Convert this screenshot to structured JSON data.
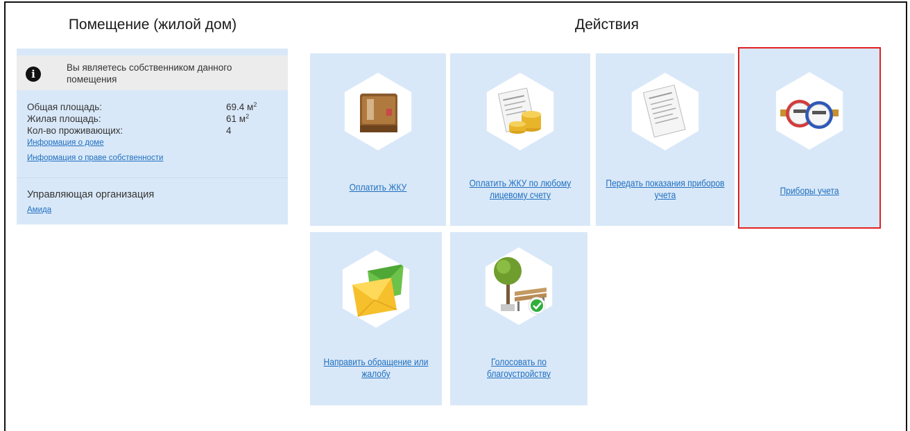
{
  "left_panel": {
    "title": "Помещение (жилой дом)",
    "notice": "Вы являетесь собственником данного помещения",
    "notice_icon": "info-icon",
    "properties": [
      {
        "label": "Общая площадь:",
        "value": "69.4 м",
        "sup": "2"
      },
      {
        "label": "Жилая площадь:",
        "value": "61 м",
        "sup": "2"
      },
      {
        "label": "Кол-во проживающих:",
        "value": "4",
        "sup": ""
      }
    ],
    "links": [
      "Информация о доме",
      "Информация о праве собственности"
    ],
    "management_label": "Управляющая организация",
    "management_link": "Амида"
  },
  "actions": {
    "title": "Действия",
    "tiles": [
      {
        "label": "Оплатить ЖКУ",
        "icon": "wallet-icon"
      },
      {
        "label": "Оплатить ЖКУ по любому лицевому счету",
        "icon": "receipt-coins-icon"
      },
      {
        "label": "Передать показания приборов учета",
        "icon": "receipt-icon"
      },
      {
        "label": "Приборы учета",
        "icon": "water-meter-icon",
        "highlighted": true
      },
      {
        "label": "Направить обращение или жалобу",
        "icon": "envelope-icon"
      },
      {
        "label": "Голосовать по благоустройству",
        "icon": "tree-bench-icon"
      }
    ]
  },
  "colors": {
    "panel_bg": "#d9e8f8",
    "link": "#1f6fc0",
    "highlight": "#e0201f"
  }
}
